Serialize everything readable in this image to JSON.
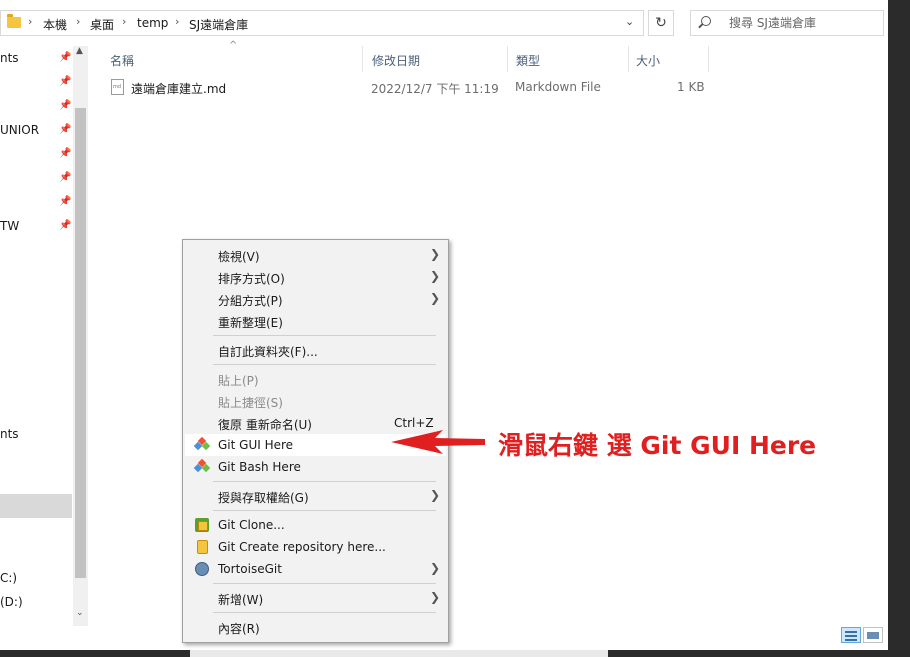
{
  "breadcrumb": [
    "本機",
    "桌面",
    "temp",
    "SJ遠端倉庫"
  ],
  "breadcrumb_sep": "›",
  "search": {
    "placeholder": "搜尋 SJ遠端倉庫"
  },
  "nav": {
    "items": [
      "nts",
      "UNIOR",
      "TW",
      "nts",
      "C:)",
      "(D:)"
    ]
  },
  "columns": {
    "name": "名稱",
    "modified": "修改日期",
    "type": "類型",
    "size": "大小"
  },
  "files": [
    {
      "name": "遠端倉庫建立.md",
      "modified": "2022/12/7 下午 11:19",
      "type": "Markdown File",
      "size": "1 KB"
    }
  ],
  "menu": {
    "view": "檢視(V)",
    "sort": "排序方式(O)",
    "group": "分組方式(P)",
    "refresh": "重新整理(E)",
    "customize": "自訂此資料夾(F)...",
    "paste": "貼上(P)",
    "paste_shortcut": "貼上捷徑(S)",
    "undo": "復原 重新命名(U)",
    "undo_key": "Ctrl+Z",
    "git_gui": "Git GUI Here",
    "git_bash": "Git Bash Here",
    "grant_access": "授與存取權給(G)",
    "git_clone": "Git Clone...",
    "git_create": "Git Create repository here...",
    "tortoise": "TortoiseGit",
    "new": "新增(W)",
    "properties": "內容(R)"
  },
  "annotation": "滑鼠右鍵 選 Git GUI Here",
  "colors": {
    "annotation": "#e02020",
    "highlight_menu": "#ffffff",
    "menu_bg": "#f2f2f2"
  }
}
